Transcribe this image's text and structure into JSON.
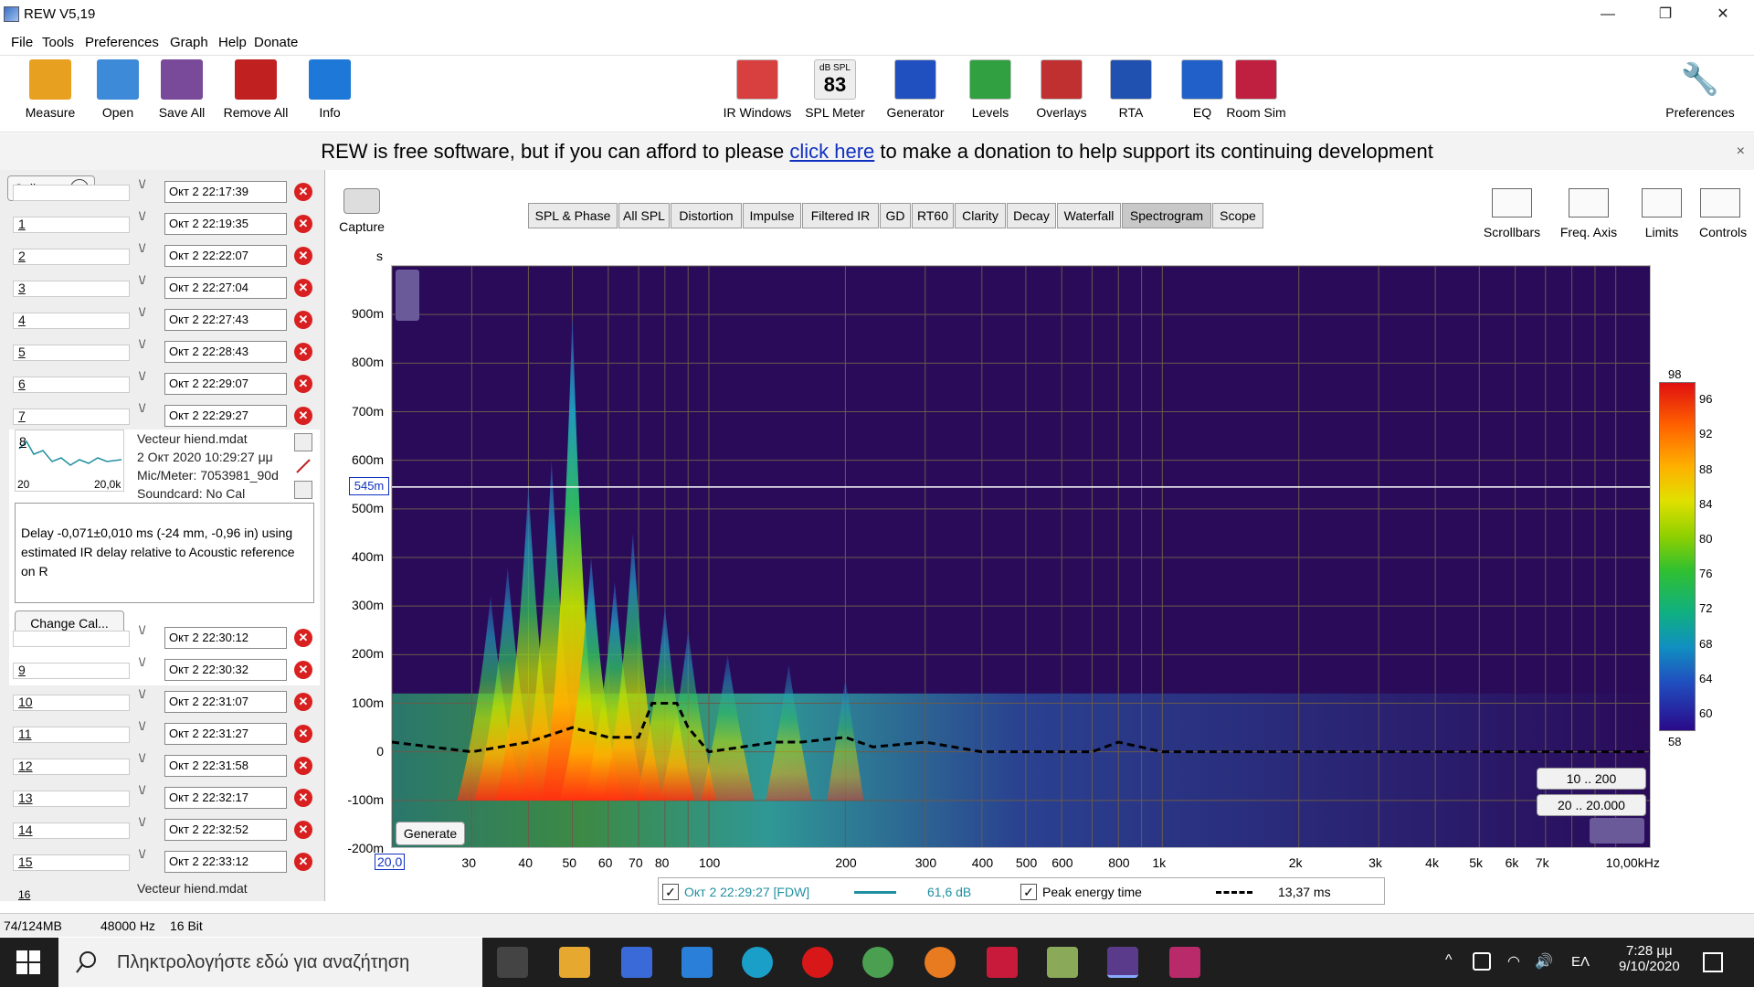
{
  "window": {
    "title": "REW V5,19",
    "minimize": "—",
    "restore": "❐",
    "close": "✕"
  },
  "menu": [
    "File",
    "Tools",
    "Preferences",
    "Graph",
    "Help",
    "Donate"
  ],
  "toolbar_left": [
    {
      "label": "Measure",
      "icon": "measure-icon",
      "color": "#e8a020"
    },
    {
      "label": "Open",
      "icon": "folder-icon",
      "color": "#3c8ad8"
    },
    {
      "label": "Save All",
      "icon": "save-icon",
      "color": "#7a4a9a"
    },
    {
      "label": "Remove All",
      "icon": "remove-icon",
      "color": "#c02020"
    },
    {
      "label": "Info",
      "icon": "info-icon",
      "color": "#1e78d8"
    }
  ],
  "toolbar_center": [
    {
      "label": "IR Windows",
      "icon": "ir-windows-icon",
      "color": "#d84040"
    },
    {
      "label": "SPL Meter",
      "icon": "spl-meter-icon",
      "color": "#eeeeee",
      "top": "dB SPL",
      "value": "83"
    },
    {
      "label": "Generator",
      "icon": "generator-icon",
      "color": "#2050c0"
    },
    {
      "label": "Levels",
      "icon": "levels-icon",
      "color": "#30a040"
    },
    {
      "label": "Overlays",
      "icon": "overlays-icon",
      "color": "#c03030"
    },
    {
      "label": "RTA",
      "icon": "rta-icon",
      "color": "#2050b0"
    },
    {
      "label": "EQ",
      "icon": "eq-icon",
      "color": "#2060c8"
    },
    {
      "label": "Room Sim",
      "icon": "room-sim-icon",
      "color": "#c02040"
    }
  ],
  "toolbar_right": {
    "label": "Preferences",
    "icon": "wrench-icon"
  },
  "banner": {
    "pre": "REW is free software, but if you can afford to please ",
    "link": "click here",
    "post": " to make a donation to help support its continuing development",
    "close": "×"
  },
  "panel": {
    "collapse": "Collapse",
    "top_rows": [
      {
        "num": "",
        "time": "Окт 2 22:17:39"
      },
      {
        "num": "1",
        "time": "Окт 2 22:19:35"
      },
      {
        "num": "2",
        "time": "Окт 2 22:22:07"
      },
      {
        "num": "3",
        "time": "Окт 2 22:27:04"
      },
      {
        "num": "4",
        "time": "Окт 2 22:27:43"
      },
      {
        "num": "5",
        "time": "Окт 2 22:28:43"
      },
      {
        "num": "6",
        "time": "Окт 2 22:29:07"
      },
      {
        "num": "7",
        "time": "Окт 2 22:29:27"
      }
    ],
    "selected": {
      "num": "8",
      "file": "Vecteur hiend.mdat",
      "date": "2 Окт 2020 10:29:27 μμ",
      "mic": "Mic/Meter: 7053981_90d",
      "sound": "Soundcard: No Cal",
      "range_lo": "20",
      "range_hi": "20,0k",
      "delay": "Delay -0,071±0,010 ms (-24 mm, -0,96 in) using estimated IR delay relative to Acoustic reference on  R",
      "change": "Change Cal..."
    },
    "bottom_rows": [
      {
        "num": "",
        "time": "Окт 2 22:30:12"
      },
      {
        "num": "9",
        "time": "Окт 2 22:30:32"
      },
      {
        "num": "10",
        "time": "Окт 2 22:31:07"
      },
      {
        "num": "11",
        "time": "Окт 2 22:31:27"
      },
      {
        "num": "12",
        "time": "Окт 2 22:31:58"
      },
      {
        "num": "13",
        "time": "Окт 2 22:32:17"
      },
      {
        "num": "14",
        "time": "Окт 2 22:32:52"
      },
      {
        "num": "15",
        "time": "Окт 2 22:33:12"
      }
    ],
    "last_num": "16",
    "last_file": "Vecteur hiend.mdat"
  },
  "graph": {
    "capture": "Capture",
    "tabs": [
      "SPL & Phase",
      "All SPL",
      "Distortion",
      "Impulse",
      "Filtered IR",
      "GD",
      "RT60",
      "Clarity",
      "Decay",
      "Waterfall",
      "Spectrogram",
      "Scope"
    ],
    "active_tab": "Spectrogram",
    "right_tools": [
      {
        "label": "Scrollbars",
        "icon": "scrollbars-icon"
      },
      {
        "label": "Freq. Axis",
        "icon": "freq-axis-icon"
      },
      {
        "label": "Limits",
        "icon": "limits-icon"
      },
      {
        "label": "Controls",
        "icon": "gear-icon"
      }
    ],
    "y_unit": "s",
    "y_ticks": [
      "900m",
      "800m",
      "700m",
      "600m",
      "500m",
      "400m",
      "300m",
      "200m",
      "100m",
      "0",
      "-100m",
      "-200m"
    ],
    "cursor_y": "545m",
    "x_ticks": [
      "20,0",
      "30",
      "40",
      "50",
      "60",
      "70",
      "80",
      "100",
      "200",
      "300",
      "400",
      "500",
      "600",
      "800",
      "1k",
      "2k",
      "3k",
      "4k",
      "5k",
      "6k",
      "7k",
      "10,00kHz"
    ],
    "generate": "Generate",
    "range1": "10 .. 200",
    "range2": "20 .. 20.000",
    "color_scale": [
      "98",
      "96",
      "92",
      "88",
      "84",
      "80",
      "76",
      "72",
      "68",
      "64",
      "60",
      "58"
    ]
  },
  "legend": {
    "series": "Окт 2 22:29:27 [FDW]",
    "value": "61,6 dB",
    "peak": "Peak energy time",
    "peak_value": "13,37 ms",
    "series_color": "#2090a0"
  },
  "status": {
    "mem": "74/124MB",
    "rate": "48000 Hz",
    "bits": "16 Bit"
  },
  "chart_data": {
    "type": "heatmap",
    "xlabel": "",
    "ylabel": "s",
    "x_scale": "log",
    "xlim": [
      20,
      12000
    ],
    "ylim": [
      -0.2,
      1.0
    ],
    "color_range_db": [
      58,
      98
    ],
    "cursor_time": 0.545,
    "peaks": [
      {
        "freq": 33,
        "decay_s": 0.32,
        "level_db": 84
      },
      {
        "freq": 36,
        "decay_s": 0.38,
        "level_db": 86
      },
      {
        "freq": 40,
        "decay_s": 0.55,
        "level_db": 88
      },
      {
        "freq": 45,
        "decay_s": 0.6,
        "level_db": 90
      },
      {
        "freq": 50,
        "decay_s": 0.9,
        "level_db": 96
      },
      {
        "freq": 55,
        "decay_s": 0.4,
        "level_db": 92
      },
      {
        "freq": 62,
        "decay_s": 0.35,
        "level_db": 90
      },
      {
        "freq": 68,
        "decay_s": 0.45,
        "level_db": 88
      },
      {
        "freq": 80,
        "decay_s": 0.3,
        "level_db": 86
      },
      {
        "freq": 90,
        "decay_s": 0.25,
        "level_db": 82
      },
      {
        "freq": 110,
        "decay_s": 0.2,
        "level_db": 80
      },
      {
        "freq": 150,
        "decay_s": 0.18,
        "level_db": 78
      },
      {
        "freq": 200,
        "decay_s": 0.15,
        "level_db": 76
      }
    ],
    "peak_energy_time": [
      [
        20,
        0.02
      ],
      [
        30,
        0.0
      ],
      [
        40,
        0.02
      ],
      [
        50,
        0.05
      ],
      [
        60,
        0.03
      ],
      [
        70,
        0.03
      ],
      [
        75,
        0.1
      ],
      [
        85,
        0.1
      ],
      [
        90,
        0.05
      ],
      [
        100,
        0.0
      ],
      [
        140,
        0.02
      ],
      [
        160,
        0.02
      ],
      [
        200,
        0.03
      ],
      [
        230,
        0.01
      ],
      [
        300,
        0.02
      ],
      [
        400,
        0.0
      ],
      [
        700,
        0.0
      ],
      [
        800,
        0.02
      ],
      [
        1000,
        0.0
      ],
      [
        12000,
        0.0
      ]
    ]
  }
}
